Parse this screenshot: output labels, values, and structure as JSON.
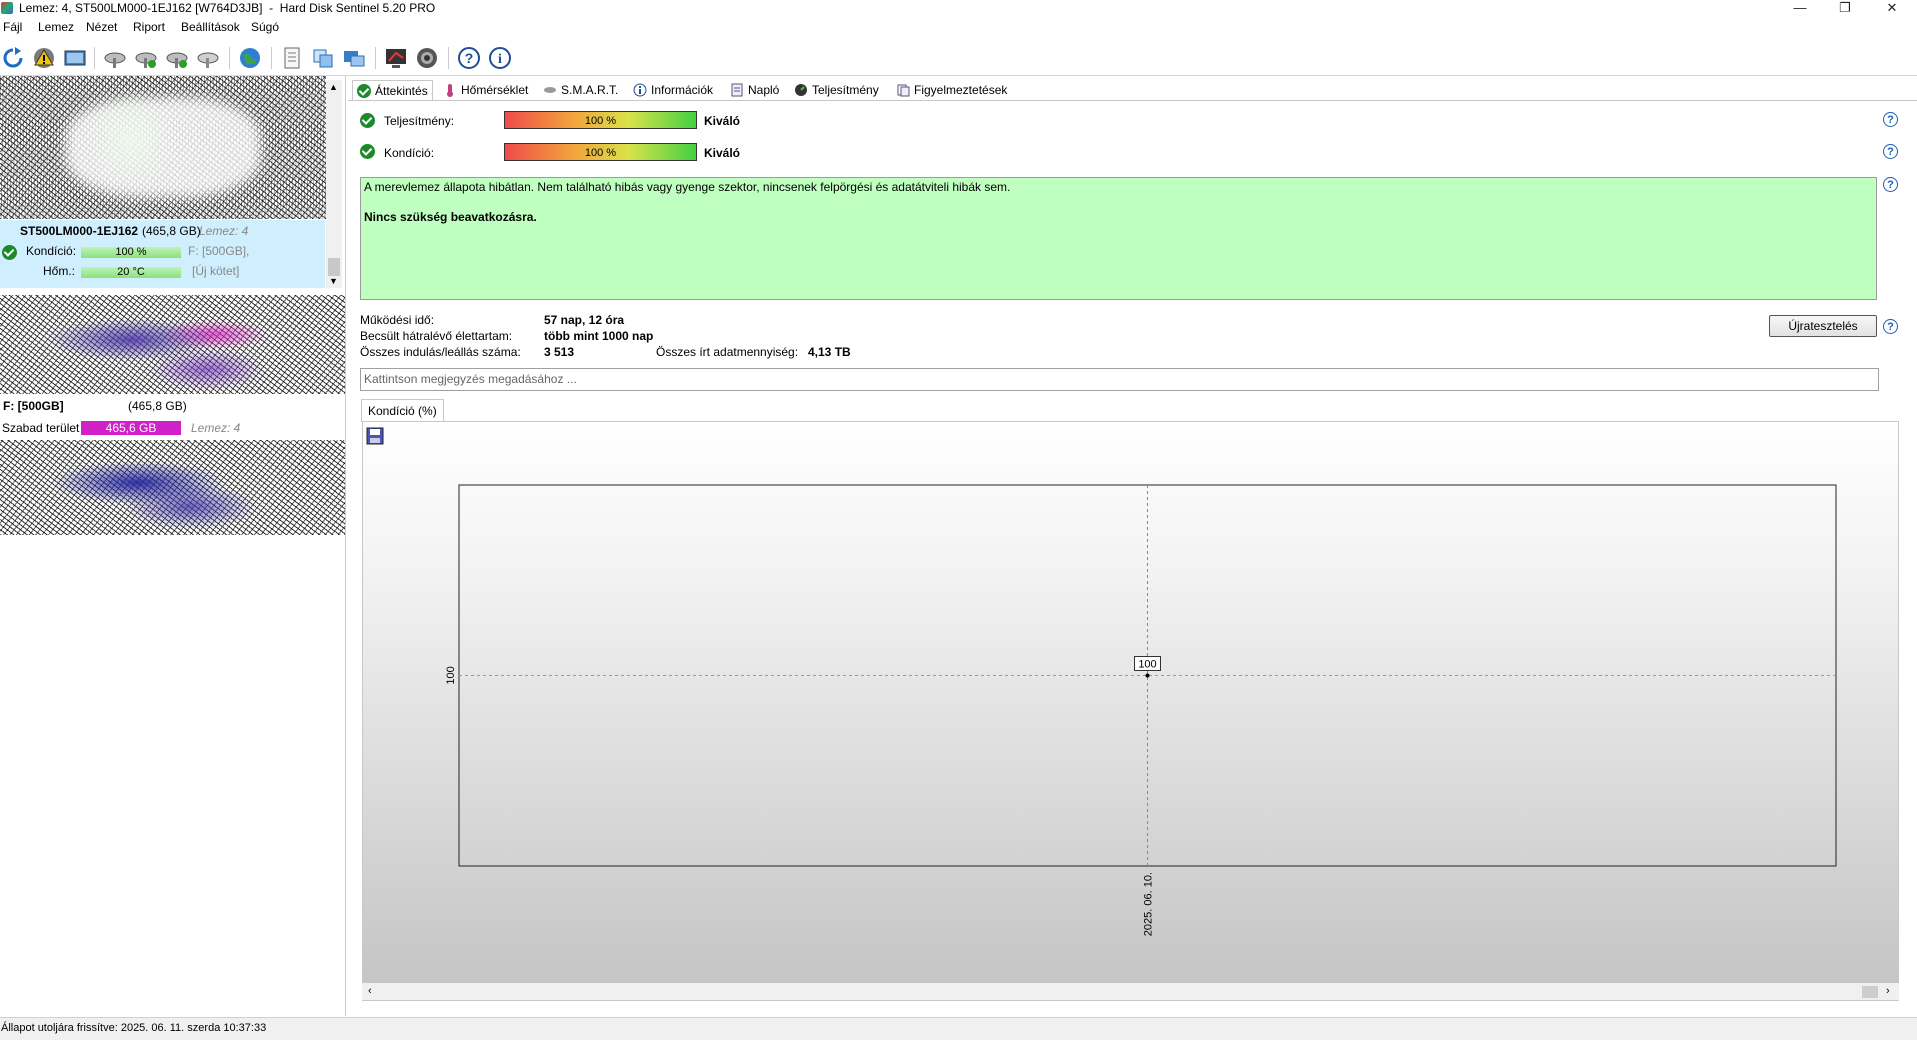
{
  "window": {
    "title": "Lemez: 4, ST500LM000-1EJ162 [W764D3JB]  -  Hard Disk Sentinel 5.20 PRO",
    "controls": {
      "minimize": "—",
      "restore": "❐",
      "close": "✕"
    }
  },
  "menu": [
    "Fájl",
    "Lemez",
    "Nézet",
    "Riport",
    "Beállítások",
    "Súgó"
  ],
  "toolbar": {
    "icons": [
      "refresh-icon",
      "alert-icon",
      "disk-image-icon",
      "disk-tool-1-icon",
      "disk-tool-2-icon",
      "disk-tool-3-icon",
      "disk-tool-4-icon",
      "globe-icon",
      "report-icon",
      "transfer-icon",
      "cloud-icon",
      "monitor-icon",
      "speaker-icon",
      "help-icon",
      "info-icon"
    ]
  },
  "disk_list": {
    "disk_name": "ST500LM000-1EJ162",
    "disk_size": "(465,8 GB)",
    "disk_index": "Lemez: 4",
    "condition_label": "Kondíció:",
    "condition_value": "100 %",
    "condition_fraction": 1.0,
    "partition_label": "F: [500GB],",
    "temp_label": "Hőm.:",
    "temp_value": "20 °C",
    "volume_label": "[Új kötet]",
    "volume_name": "F: [500GB]",
    "volume_size": "(465,8 GB)",
    "free_label": "Szabad terület",
    "free_value": "465,6 GB",
    "free_disk": "Lemez: 4"
  },
  "tabs": [
    {
      "label": "Áttekintés",
      "icon": "check-icon",
      "active": true
    },
    {
      "label": "Hőmérséklet",
      "icon": "thermometer-icon"
    },
    {
      "label": "S.M.A.R.T.",
      "icon": "smart-icon"
    },
    {
      "label": "Információk",
      "icon": "info-icon"
    },
    {
      "label": "Napló",
      "icon": "log-icon"
    },
    {
      "label": "Teljesítmény",
      "icon": "gauge-icon"
    },
    {
      "label": "Figyelmeztetések",
      "icon": "warnings-icon"
    }
  ],
  "overview": {
    "performance_label": "Teljesítmény:",
    "performance_value": "100 %",
    "performance_fraction": 1.0,
    "performance_word": "Kiváló",
    "health_label": "Kondíció:",
    "health_value": "100 %",
    "health_fraction": 1.0,
    "health_word": "Kiváló",
    "summary_line": "A merevlemez állapota hibátlan. Nem található hibás vagy gyenge szektor, nincsenek felpörgési és adatátviteli hibák sem.",
    "summary_action": "Nincs szükség beavatkozásra.",
    "uptime_label": "Működési idő:",
    "uptime_value": "57 nap, 12 óra",
    "lifetime_label": "Becsült hátralévő élettartam:",
    "lifetime_value": "több mint 1000 nap",
    "startstop_label": "Összes indulás/leállás száma:",
    "startstop_value": "3 513",
    "written_label": "Összes írt adatmennyiség:",
    "written_value": "4,13 TB",
    "retest_button": "Újratesztelés",
    "comment_placeholder": "Kattintson megjegyzés megadásához ...",
    "help": "?"
  },
  "chart_tab": "Kondíció  (%)",
  "chart_data": {
    "type": "line",
    "x": [
      "2025. 06. 10."
    ],
    "series": [
      {
        "values": [
          100
        ]
      }
    ],
    "data_labels": [
      "100"
    ],
    "y_ticks": [
      "100"
    ],
    "x_ticks": [
      "2025. 06. 10."
    ],
    "grid": true,
    "color": "#000000"
  },
  "status_bar": "Állapot utoljára frissítve: 2025. 06. 11. szerda 10:37:33",
  "colors": {
    "summary_bg": "#bfffbf",
    "free_bar": "#d020c8",
    "ok": "#1d8a2a",
    "disk_card_bg": "#cfefff"
  }
}
